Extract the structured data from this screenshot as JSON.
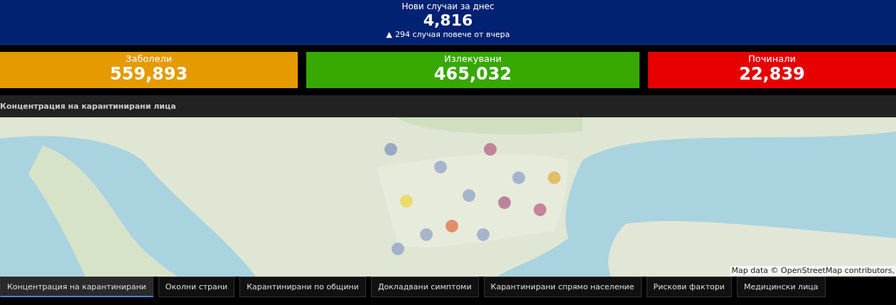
{
  "header": {
    "title": "Нови случаи за днес",
    "value": "4,816",
    "change_icon": "▲",
    "change": "294 случая повече от вчера"
  },
  "cards": [
    {
      "label": "Заболели",
      "value": "559,893",
      "color": "#e59a00"
    },
    {
      "label": "Излекувани",
      "value": "465,032",
      "color": "#37a800"
    },
    {
      "label": "Починали",
      "value": "22,839",
      "color": "#e60000"
    }
  ],
  "panel": {
    "title": "Концентрация на карантинирани лица",
    "map": {
      "attribution": "Map data © OpenStreetMap contributors,"
    }
  },
  "tabs": [
    {
      "label": "Концентрация на карантинирани",
      "selected": true
    },
    {
      "label": "Околни страни",
      "selected": false
    },
    {
      "label": "Карантинирани по общини",
      "selected": false
    },
    {
      "label": "Докладвани симптоми",
      "selected": false
    },
    {
      "label": "Карантинирани спрямо население",
      "selected": false
    },
    {
      "label": "Рискови фактори",
      "selected": false
    },
    {
      "label": "Медицински лица",
      "selected": false
    }
  ]
}
